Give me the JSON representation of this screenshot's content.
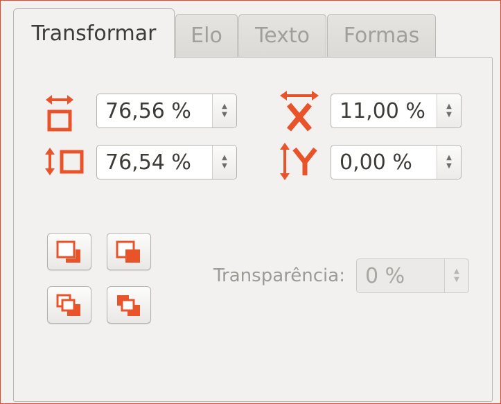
{
  "tabs": [
    {
      "label": "Transformar",
      "active": true
    },
    {
      "label": "Elo",
      "active": false
    },
    {
      "label": "Texto",
      "active": false
    },
    {
      "label": "Formas",
      "active": false
    }
  ],
  "transform": {
    "width_scale": {
      "value": "76,56 %",
      "icon": "width-scale-icon"
    },
    "height_scale": {
      "value": "76,54 %",
      "icon": "height-scale-icon"
    },
    "x_offset": {
      "value": "11,00 %",
      "icon": "x-offset-icon"
    },
    "y_offset": {
      "value": "0,00 %",
      "icon": "y-offset-icon"
    }
  },
  "arrange": {
    "buttons": [
      "bring-forward-icon",
      "send-backward-icon",
      "bring-to-front-icon",
      "send-to-back-icon"
    ]
  },
  "transparency": {
    "label": "Transparência:",
    "value": "0 %",
    "enabled": false
  },
  "colors": {
    "accent": "#e9532a",
    "border": "#e04a2c"
  }
}
